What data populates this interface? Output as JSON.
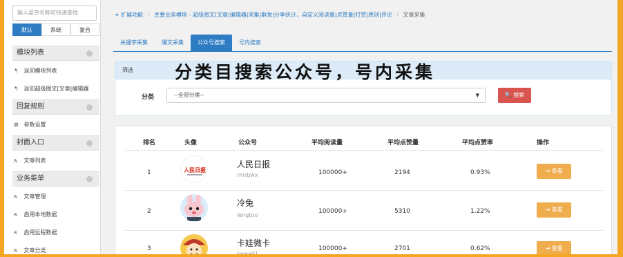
{
  "sidebar": {
    "search_placeholder": "输入菜单名称可快速查找",
    "tabs": [
      "默认",
      "系统",
      "复合"
    ],
    "groups": [
      "模块列表",
      "回复规则",
      "封面入口",
      "业务菜单"
    ],
    "items": [
      {
        "label": "返回模块列表",
        "icon": "back-icon"
      },
      {
        "label": "返回超级图文[文章|编辑器",
        "icon": "back-icon"
      },
      {
        "label": "参数设置",
        "icon": "gear-icon"
      },
      {
        "label": "文章列表",
        "icon": "sitemap-icon"
      },
      {
        "label": "文章管理",
        "icon": "sitemap-icon"
      },
      {
        "label": "启用本地数据",
        "icon": "sitemap-icon"
      },
      {
        "label": "启用远程数据",
        "icon": "sitemap-icon"
      },
      {
        "label": "文章分类",
        "icon": "sitemap-icon"
      }
    ]
  },
  "breadcrumb": {
    "items": [
      "扩展功能",
      "主要业务模块 - 超级图文[文章|编辑器|采集|群发|分享统计，自定义阅读量|点赞量|打赏|原创|评论",
      "文章采集"
    ]
  },
  "tabs": [
    "关键字采集",
    "爆文采集",
    "公众号搜索",
    "号内搜索"
  ],
  "active_tab": 2,
  "filter": {
    "heading": "筛选",
    "overlay_title": "分类目搜索公众号，号内采集",
    "category_label": "分类",
    "category_value": "--全部分类--",
    "search_button": "搜索"
  },
  "table": {
    "headers": [
      "排名",
      "头像",
      "公众号",
      "平均阅读量",
      "平均点赞量",
      "平均点赞率",
      "操作"
    ],
    "rows": [
      {
        "rank": "1",
        "name": "人民日报",
        "wxid": "rmrbwx",
        "avg_read": "100000+",
        "avg_like": "2194",
        "like_rate": "0.93%",
        "action": "查看"
      },
      {
        "rank": "2",
        "name": "冷兔",
        "wxid": "lengtoo",
        "avg_read": "100000+",
        "avg_like": "5310",
        "like_rate": "1.22%",
        "action": "查看"
      },
      {
        "rank": "3",
        "name": "卡娃微卡",
        "wxid": "kawa01",
        "avg_read": "100000+",
        "avg_like": "2701",
        "like_rate": "0.62%",
        "action": "查看"
      }
    ]
  },
  "avatar_texts": {
    "rmrb": "人民日报"
  },
  "colors": {
    "primary": "#2d7cc4",
    "danger": "#d9534f",
    "warning": "#f0ad4e",
    "frame": "#f5a623"
  }
}
